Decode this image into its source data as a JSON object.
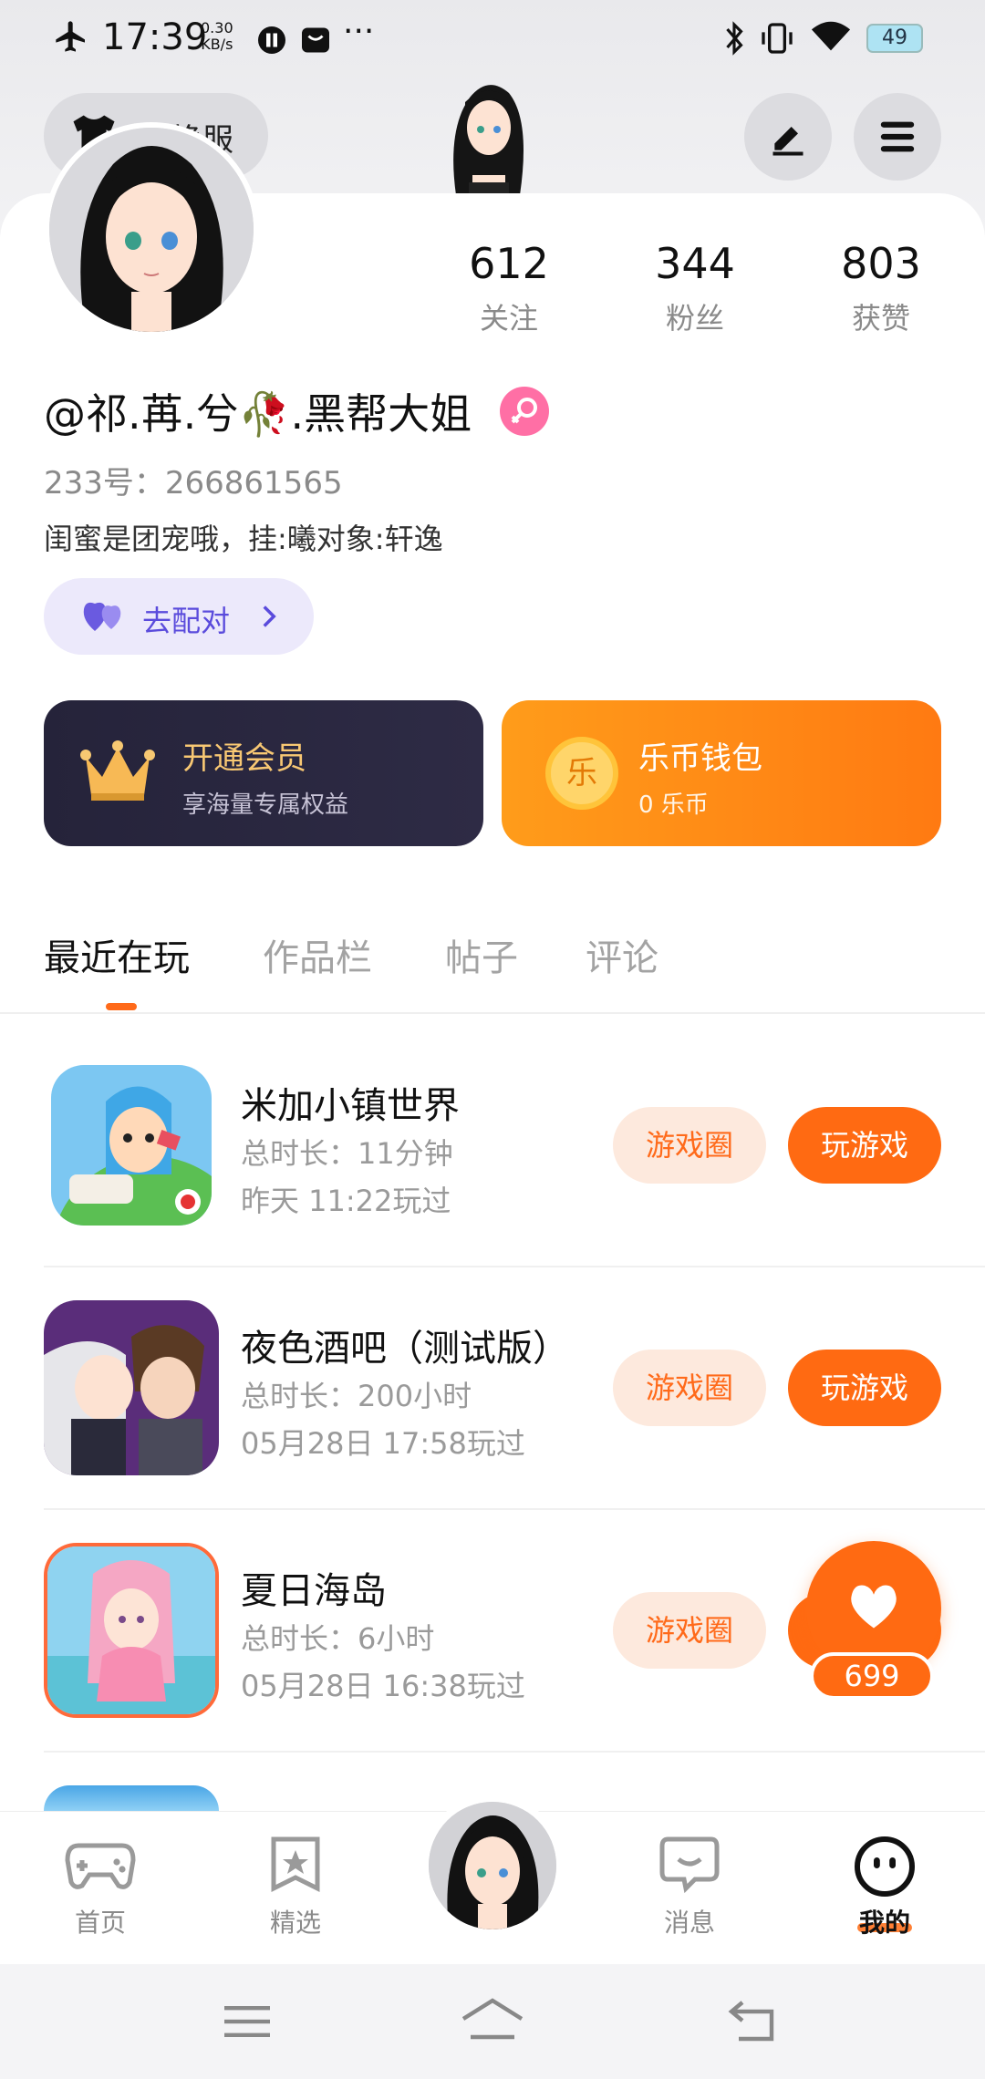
{
  "status_bar": {
    "time": "17:39",
    "speed_value": "0.30",
    "speed_unit": "KB/s",
    "more": "···",
    "battery": "49"
  },
  "header": {
    "skin_button_label": "换服",
    "edit_icon": "pencil-icon",
    "menu_icon": "hamburger-icon"
  },
  "profile": {
    "stats": [
      {
        "value": "612",
        "label": "关注"
      },
      {
        "value": "344",
        "label": "粉丝"
      },
      {
        "value": "803",
        "label": "获赞"
      }
    ],
    "username": "@祁.苒.兮🥀.黑帮大姐",
    "uid": "233号：266861565",
    "bio": "闺蜜是团宠哦，挂:曦对象:轩逸",
    "match_button": "去配对"
  },
  "cards": {
    "vip": {
      "title": "开通会员",
      "subtitle": "享海量专属权益"
    },
    "wallet": {
      "title": "乐币钱包",
      "subtitle": "0 乐币",
      "coin_char": "乐"
    }
  },
  "tabs": [
    "最近在玩",
    "作品栏",
    "帖子",
    "评论"
  ],
  "games": [
    {
      "title": "米加小镇世界",
      "duration": "总时长：11分钟",
      "last_played": "昨天 11:22玩过",
      "circle_label": "游戏圈",
      "play_label": "玩游戏"
    },
    {
      "title": "夜色酒吧（测试版）",
      "duration": "总时长：200小时",
      "last_played": "05月28日 17:58玩过",
      "circle_label": "游戏圈",
      "play_label": "玩游戏"
    },
    {
      "title": "夏日海岛",
      "duration": "总时长：6小时",
      "last_played": "05月28日 16:38玩过",
      "circle_label": "游戏圈",
      "play_label": "玩游戏"
    }
  ],
  "like_fab": {
    "count": "699"
  },
  "bottom_nav": [
    {
      "label": "首页",
      "icon": "gamepad-icon"
    },
    {
      "label": "精选",
      "icon": "star-bookmark-icon"
    },
    {
      "label": "",
      "icon": "avatar-center"
    },
    {
      "label": "消息",
      "icon": "chat-bubble-icon"
    },
    {
      "label": "我的",
      "icon": "smiley-face-icon"
    }
  ],
  "colors": {
    "accent": "#ff6a12",
    "vip_bg": "#25233a",
    "vip_text": "#f8c873",
    "match_text": "#5a4bdc"
  }
}
